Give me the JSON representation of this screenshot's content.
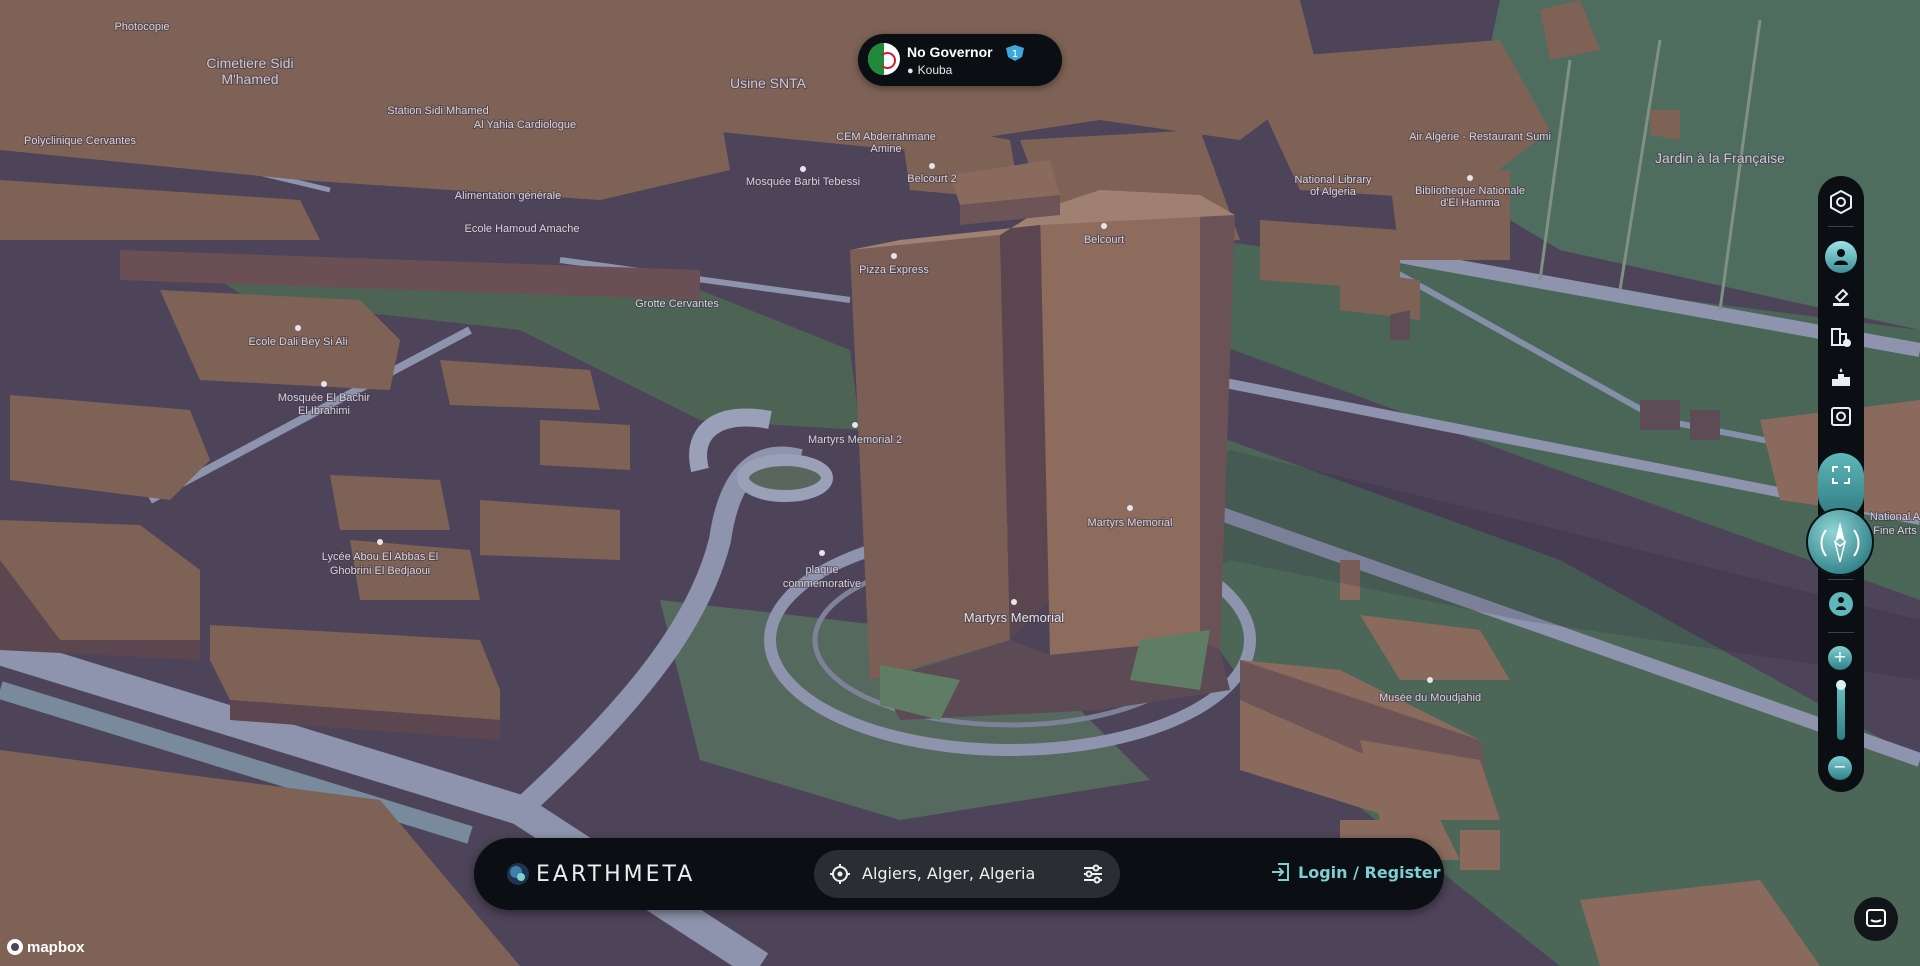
{
  "governor": {
    "title": "No Governor",
    "badge_count": "1",
    "location": "Kouba"
  },
  "map_labels": {
    "cemetery": "Cimetiere Sidi",
    "cemetery_2": "M'hamed",
    "usine": "Usine SNTA",
    "photocopie": "Photocopie",
    "cem": "CEM Abderrahmane",
    "cem_2": "Amine",
    "mosquee_barbi": "Mosquée Barbi Tebessi",
    "belcourt2": "Belcourt 2",
    "belcourt": "Belcourt",
    "pizza": "Pizza Express",
    "grotte": "Grotte Cervantes",
    "national_library": "National Library",
    "national_library_2": "of Algeria",
    "bibliotheque": "Bibliotheque Nationale",
    "bibliotheque_2": "d'El Hamma",
    "air_algerie": "Air Algérie - Restaurant Sumi",
    "jardin": "Jardin à la Française",
    "station": "Station Sidi Mhamed",
    "alyahia": "Al Yahia Cardiologue",
    "polyclinique": "Polyclinique Cervantes",
    "alimentation": "Alimentation générale",
    "ecole_hamoud": "Ecole Hamoud Amache",
    "ecole_dali": "Ecole Dali Bey Si Ali",
    "mosquee_bachir": "Mosquée El Bachir",
    "mosquee_bachir_2": "El Ibrahimi",
    "martyrs2": "Martyrs Memorial 2",
    "plaque": "plaque",
    "plaque_2": "commemorative",
    "martyrs_right": "Martyrs Memorial",
    "martyrs_center": "Martyrs Memorial",
    "lycee": "Lycée Abou El Abbas El",
    "lycee_2": "Ghobrini El Bedjaoui",
    "musee": "Musée du Moudjahid",
    "national_arts": "National A",
    "national_arts_2": "Fine Arts"
  },
  "toolbar": {
    "icons": [
      "governance-icon",
      "location-person-icon",
      "stamp-icon",
      "buildings-dollar-icon",
      "podium-icon",
      "vault-icon"
    ],
    "expand_icon": "expand-icon",
    "compass_icon": "compass-icon",
    "street_view_icon": "street-view-icon",
    "zoom_in": "+",
    "zoom_out": "−",
    "zoom_level_fraction": 0.0
  },
  "bottom_bar": {
    "brand": "EARTHMETA",
    "search_value": "Algiers, Alger, Algeria",
    "login_label": "Login / Register"
  },
  "attribution": {
    "mapbox": "mapbox"
  },
  "colors": {
    "accent": "#7fcfd2",
    "panel": "#0b0e12",
    "building": "#8a6a5c",
    "ground": "#4e4459",
    "grass": "#4f6b5c",
    "road": "#8e94ad"
  }
}
